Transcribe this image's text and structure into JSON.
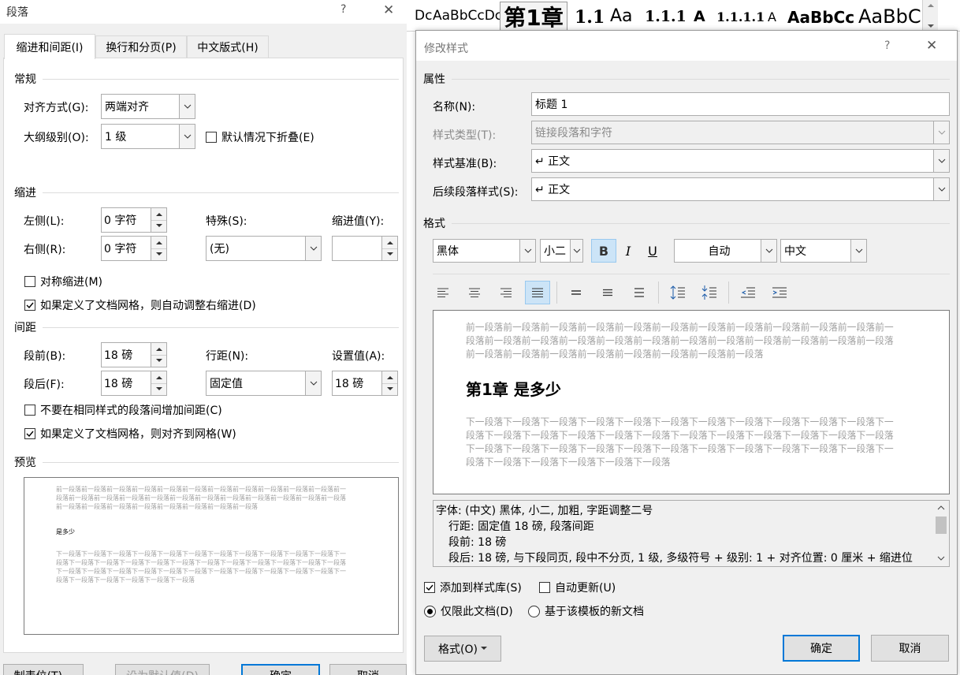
{
  "para": {
    "title": "段落",
    "help": "?",
    "close": "✕",
    "tabs": [
      {
        "label": "缩进和间距(I)"
      },
      {
        "label": "换行和分页(P)"
      },
      {
        "label": "中文版式(H)"
      }
    ],
    "general": {
      "title": "常规",
      "align_label": "对齐方式(G):",
      "align_value": "两端对齐",
      "outline_label": "大纲级别(O):",
      "outline_value": "1 级",
      "collapse_label": "默认情况下折叠(E)"
    },
    "indent": {
      "title": "缩进",
      "left_label": "左侧(L):",
      "left_value": "0 字符",
      "right_label": "右侧(R):",
      "right_value": "0 字符",
      "special_label": "特殊(S):",
      "special_value": "(无)",
      "by_label": "缩进值(Y):",
      "by_value": "",
      "mirror_label": "对称缩进(M)",
      "autoadjust_label": "如果定义了文档网格，则自动调整右缩进(D)"
    },
    "spacing": {
      "title": "间距",
      "before_label": "段前(B):",
      "before_value": "18 磅",
      "after_label": "段后(F):",
      "after_value": "18 磅",
      "line_label": "行距(N):",
      "line_value": "固定值",
      "at_label": "设置值(A):",
      "at_value": "18 磅",
      "nospace_label": "不要在相同样式的段落间增加间距(C)",
      "snap_label": "如果定义了文档网格，则对齐到网格(W)"
    },
    "preview": {
      "title": "预览",
      "prev_text": "前一段落前一段落前一段落前一段落前一段落前一段落前一段落前一段落前一段落前一段落前一段落前一段落前一段落前一段落前一段落前一段落前一段落前一段落前一段落前一段落前一段落前一段落前一段落前一段落前一段落前一段落前一段落前一段落前一段落前一段落前一段落",
      "sample": "是多少",
      "next_text": "下一段落下一段落下一段落下一段落下一段落下一段落下一段落下一段落下一段落下一段落下一段落下一段落下一段落下一段落下一段落下一段落下一段落下一段落下一段落下一段落下一段落下一段落下一段落下一段落下一段落下一段落下一段落下一段落下一段落下一段落下一段落下一段落下一段落下一段落下一段落下一段落下一段落下一段落下一段落下一段落"
    },
    "buttons": {
      "tabs": "制表位(T)...",
      "default": "设为默认值(D)",
      "ok": "确定",
      "cancel": "取消"
    }
  },
  "gallery": {
    "items": [
      "Dc",
      "AaBbCcDc",
      "第1章",
      "1.1",
      "Aa",
      "1.1.1",
      "A",
      "1.1.1.1",
      "A",
      "AaBbCc",
      "AaBbC"
    ]
  },
  "modify": {
    "title": "修改样式",
    "help": "?",
    "close": "✕",
    "properties": {
      "title": "属性",
      "name_label": "名称(N):",
      "name_value": "标题 1",
      "type_label": "样式类型(T):",
      "type_value": "链接段落和字符",
      "based_label": "样式基准(B):",
      "based_value": "↵ 正文",
      "next_label": "后续段落样式(S):",
      "next_value": "↵ 正文"
    },
    "format": {
      "title": "格式",
      "font": "黑体",
      "size": "小二",
      "bold": "B",
      "italic": "I",
      "underline": "U",
      "color": "自动",
      "lang": "中文"
    },
    "preview": {
      "prev_text": "前一段落前一段落前一段落前一段落前一段落前一段落前一段落前一段落前一段落前一段落前一段落前一段落前一段落前一段落前一段落前一段落前一段落前一段落前一段落前一段落前一段落前一段落前一段落前一段落前一段落前一段落前一段落前一段落前一段落前一段落前一段落",
      "heading": "第1章 是多少",
      "next_text": "下一段落下一段落下一段落下一段落下一段落下一段落下一段落下一段落下一段落下一段落下一段落下一段落下一段落下一段落下一段落下一段落下一段落下一段落下一段落下一段落下一段落下一段落下一段落下一段落下一段落下一段落下一段落下一段落下一段落下一段落下一段落下一段落下一段落下一段落下一段落下一段落下一段落下一段落下一段落下一段落"
    },
    "description": [
      "字体: (中文) 黑体, 小二, 加粗, 字距调整二号",
      "行距: 固定值 18 磅, 段落间距",
      "段前: 18 磅",
      "段后: 18 磅, 与下段同页, 段中不分页, 1 级, 多级符号 + 级别: 1 + 对齐位置:  0 厘米 + 缩进位"
    ],
    "add_gallery_label": "添加到样式库(S)",
    "auto_update_label": "自动更新(U)",
    "only_doc_label": "仅限此文档(D)",
    "template_label": "基于该模板的新文档",
    "buttons": {
      "format": "格式(O)",
      "ok": "确定",
      "cancel": "取消"
    }
  },
  "colors": {
    "accent": "#0078d7",
    "dialog_bg": "#f0f0f0",
    "preview_text": "#a0a0a0"
  }
}
